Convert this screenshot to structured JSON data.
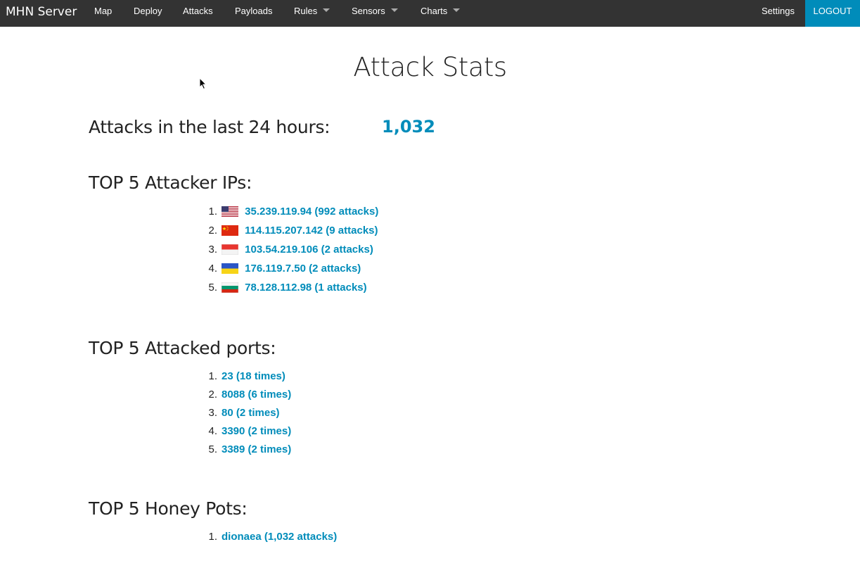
{
  "brand": "MHN Server",
  "nav": {
    "map": "Map",
    "deploy": "Deploy",
    "attacks": "Attacks",
    "payloads": "Payloads",
    "rules": "Rules",
    "sensors": "Sensors",
    "charts": "Charts",
    "settings": "Settings",
    "logout": "LOGOUT"
  },
  "page_title": "Attack Stats",
  "last24": {
    "label": "Attacks in the last 24 hours:",
    "count": "1,032"
  },
  "top_ips": {
    "heading": "TOP 5 Attacker IPs:",
    "items": [
      {
        "num": "1.",
        "flag": "us-flag-icon",
        "text": "35.239.119.94 (992 attacks)"
      },
      {
        "num": "2.",
        "flag": "cn-flag-icon",
        "text": "114.115.207.142 (9 attacks)"
      },
      {
        "num": "3.",
        "flag": "id-flag-icon",
        "text": "103.54.219.106 (2 attacks)"
      },
      {
        "num": "4.",
        "flag": "ua-flag-icon",
        "text": "176.119.7.50 (2 attacks)"
      },
      {
        "num": "5.",
        "flag": "bg-flag-icon",
        "text": "78.128.112.98 (1 attacks)"
      }
    ]
  },
  "top_ports": {
    "heading": "TOP 5 Attacked ports:",
    "items": [
      {
        "num": "1.",
        "text": "23 (18 times)"
      },
      {
        "num": "2.",
        "text": "8088 (6 times)"
      },
      {
        "num": "3.",
        "text": "80 (2 times)"
      },
      {
        "num": "4.",
        "text": "3390 (2 times)"
      },
      {
        "num": "5.",
        "text": "3389 (2 times)"
      }
    ]
  },
  "top_honeypots": {
    "heading": "TOP 5 Honey Pots:",
    "items": [
      {
        "num": "1.",
        "text": "dionaea (1,032 attacks)"
      }
    ]
  },
  "colors": {
    "topbar": "#333333",
    "accent": "#008cba",
    "text": "#222222"
  }
}
